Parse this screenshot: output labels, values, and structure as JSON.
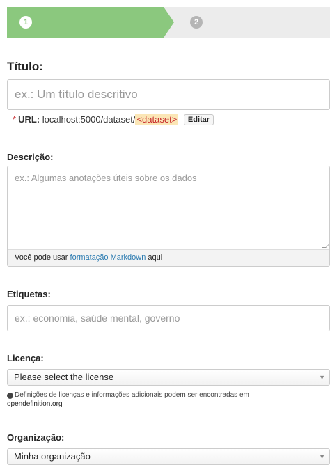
{
  "stepper": {
    "steps": [
      {
        "number": "1",
        "state": "active"
      },
      {
        "number": "2",
        "state": "inactive"
      }
    ],
    "active_color": "#8bc87e"
  },
  "title_field": {
    "label": "Título:",
    "placeholder": "ex.: Um título descritivo"
  },
  "url": {
    "required_mark": "*",
    "label": "URL:",
    "base": "localhost:5000/dataset/",
    "slug": "<dataset>",
    "edit_label": "Editar"
  },
  "description": {
    "label": "Descrição:",
    "placeholder": "ex.: Algumas anotações úteis sobre os dados",
    "hint_before": "Você pode usar",
    "hint_link": "formatação Markdown",
    "hint_after": "aqui"
  },
  "tags": {
    "label": "Etiquetas:",
    "placeholder": "ex.: economia, saúde mental, governo"
  },
  "license": {
    "label": "Licença:",
    "selected": "Please select the license",
    "help_text": "Definições de licenças e informações adicionais podem ser encontradas em",
    "help_link": "opendefinition.org"
  },
  "organization": {
    "label": "Organização:",
    "selected": "Minha organização"
  }
}
